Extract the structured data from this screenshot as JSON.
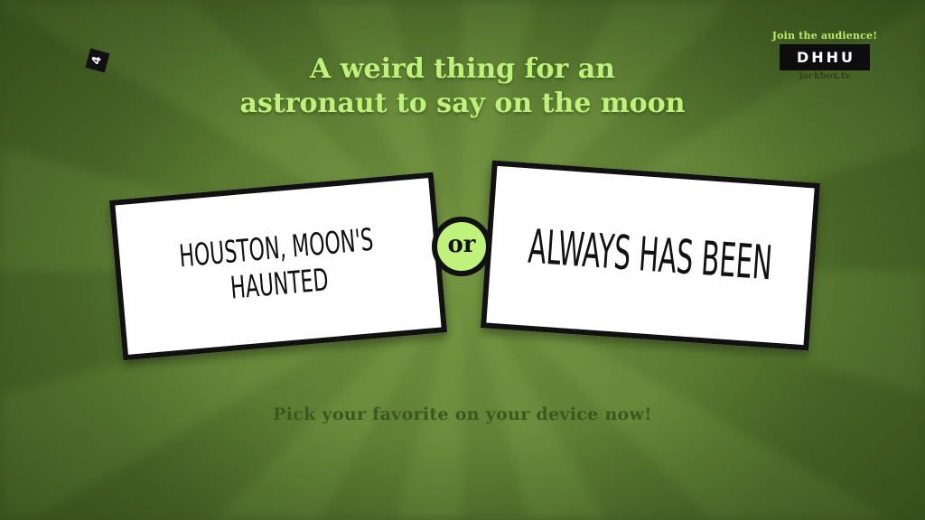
{
  "timer": {
    "value": "4"
  },
  "audience": {
    "join_label": "Join the audience!",
    "room_code": "DHHU",
    "site": "jackbox.tv"
  },
  "prompt": {
    "line1": "A weird thing for an",
    "line2": "astronaut to say on the moon"
  },
  "answers": {
    "left": {
      "line1": "Houston, moon's",
      "line2": "haunted"
    },
    "separator": "or",
    "right": {
      "line1": "Always has been"
    }
  },
  "instruction": "Pick your favorite on your device now!",
  "colors": {
    "background": "#4e6b2a",
    "accent": "#bff27a",
    "card": "#ffffff",
    "ink": "#111111"
  }
}
